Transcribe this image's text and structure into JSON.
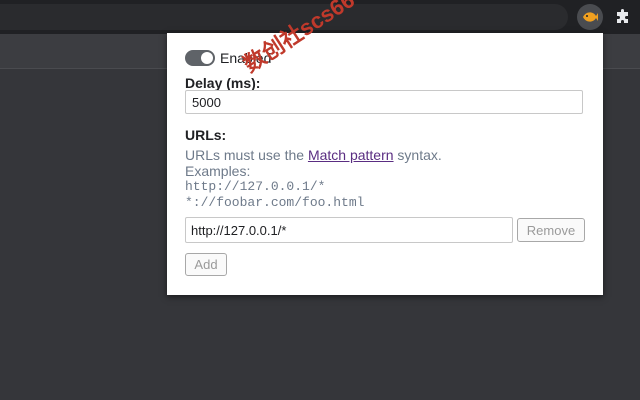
{
  "toolbar": {
    "extension_icon": "fish-extension-icon",
    "puzzle_icon": "puzzle-piece-icon"
  },
  "popup": {
    "enabled_label": "Enabled",
    "enabled": true,
    "delay_label": "Delay (ms):",
    "delay_value": "5000",
    "urls_label": "URLs:",
    "help_prefix": "URLs must use the ",
    "help_link": "Match pattern",
    "help_suffix": " syntax.",
    "examples_label": "Examples:",
    "example_1": "http://127.0.0.1/*",
    "example_2": "*://foobar.com/foo.html",
    "url_values": [
      "http://127.0.0.1/*"
    ],
    "remove_label": "Remove",
    "add_label": "Add"
  },
  "watermark": "数创社scs66",
  "colors": {
    "toggle_track": "#5f6368",
    "link": "#5a2d82",
    "help_text": "#6e7a8a",
    "watermark": "#c0392b"
  }
}
